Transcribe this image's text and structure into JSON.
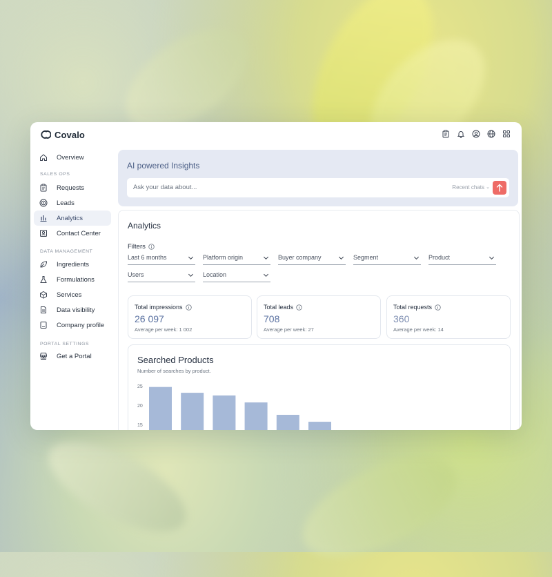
{
  "app": {
    "name": "Covalo"
  },
  "topbar": {
    "icons": [
      "clipboard-icon",
      "bell-icon",
      "user-circle-icon",
      "globe-icon",
      "apps-grid-icon"
    ]
  },
  "sidebar": {
    "items": [
      {
        "label": "Overview",
        "icon": "home-icon"
      },
      {
        "label": "Requests",
        "icon": "clipboard-icon"
      },
      {
        "label": "Leads",
        "icon": "target-icon"
      },
      {
        "label": "Analytics",
        "icon": "bar-chart-icon",
        "active": true
      },
      {
        "label": "Contact Center",
        "icon": "contact-icon"
      },
      {
        "label": "Ingredients",
        "icon": "leaf-icon"
      },
      {
        "label": "Formulations",
        "icon": "flask-icon"
      },
      {
        "label": "Services",
        "icon": "box-icon"
      },
      {
        "label": "Data visibility",
        "icon": "document-icon"
      },
      {
        "label": "Company profile",
        "icon": "building-icon"
      },
      {
        "label": "Get a Portal",
        "icon": "store-icon"
      }
    ],
    "sections": [
      "SALES OPS",
      "DATA MANAGEMENT",
      "PORTAL SETTINGS"
    ]
  },
  "ai": {
    "title": "AI powered Insights",
    "placeholder": "Ask your data about...",
    "recent_chats": "Recent chats"
  },
  "analytics": {
    "title": "Analytics",
    "filters_label": "Filters",
    "filters": [
      "Last 6 months",
      "Platform origin",
      "Buyer company",
      "Segment",
      "Product",
      "Users",
      "Location"
    ]
  },
  "cards": [
    {
      "title": "Total impressions",
      "value": "26 097",
      "sub": "Average per week: 1 002"
    },
    {
      "title": "Total leads",
      "value": "708",
      "sub": "Average per week: 27"
    },
    {
      "title": "Total requests",
      "value": "360",
      "sub": "Average per week: 14"
    }
  ],
  "colors": {
    "accent": "#5b72a1",
    "send": "#ee6b66",
    "bar": "#a6b9d8",
    "active_nav": "#eef1f7",
    "ai_panel": "#e5e9f3"
  },
  "chart_data": {
    "type": "bar",
    "title": "Searched Products",
    "subtitle": "Number of searches by product.",
    "y_ticks": [
      "25",
      "20",
      "15"
    ],
    "values": [
      24.7,
      23.2,
      22.5,
      20.7,
      17.5,
      15.7
    ],
    "ylim": [
      15,
      25
    ],
    "grid": false
  }
}
